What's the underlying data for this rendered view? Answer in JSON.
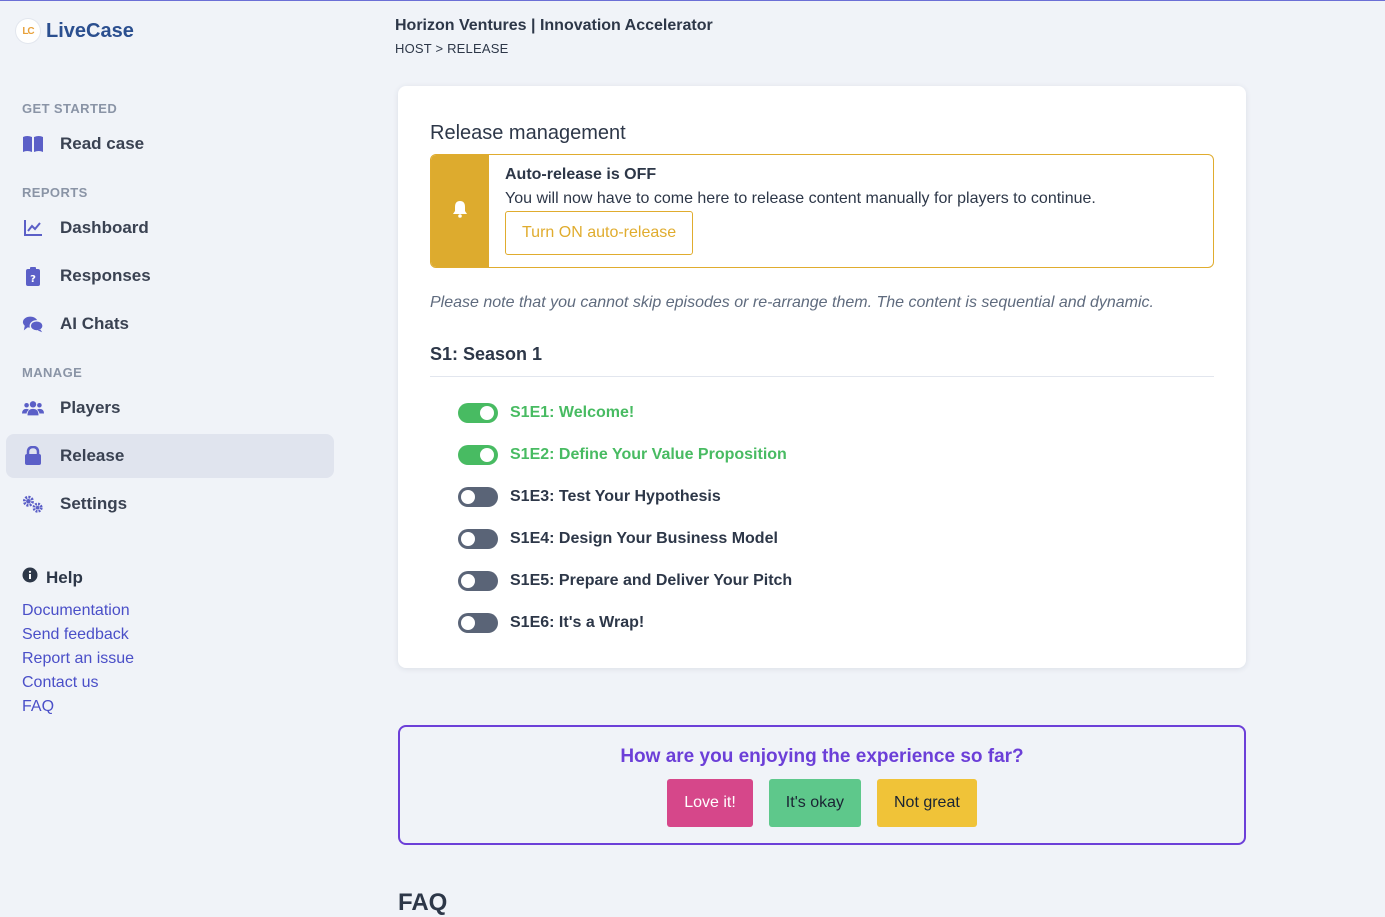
{
  "app": {
    "logo_text": "LiveCase",
    "logo_mark": "LC"
  },
  "header": {
    "title": "Horizon Ventures | Innovation Accelerator",
    "breadcrumb": "HOST > RELEASE"
  },
  "sidebar": {
    "sections": [
      {
        "label": "GET STARTED",
        "items": [
          {
            "label": "Read case",
            "icon": "book-icon"
          }
        ]
      },
      {
        "label": "REPORTS",
        "items": [
          {
            "label": "Dashboard",
            "icon": "chart-line-icon"
          },
          {
            "label": "Responses",
            "icon": "clipboard-question-icon"
          },
          {
            "label": "AI Chats",
            "icon": "chat-bubbles-icon"
          }
        ]
      },
      {
        "label": "MANAGE",
        "items": [
          {
            "label": "Players",
            "icon": "users-icon"
          },
          {
            "label": "Release",
            "icon": "lock-icon",
            "active": true
          },
          {
            "label": "Settings",
            "icon": "cogs-icon"
          }
        ]
      }
    ],
    "help": {
      "title": "Help",
      "links": [
        "Documentation",
        "Send feedback",
        "Report an issue",
        "Contact us",
        "FAQ"
      ]
    }
  },
  "release": {
    "title": "Release management",
    "alert": {
      "title": "Auto-release is OFF",
      "text": "You will now have to come here to release content manually for players to continue.",
      "button": "Turn ON auto-release",
      "color": "#ddab2e"
    },
    "note": "Please note that you cannot skip episodes or re-arrange them. The content is sequential and dynamic.",
    "season": "S1: Season 1",
    "episodes": [
      {
        "label": "S1E1: Welcome!",
        "released": true
      },
      {
        "label": "S1E2: Define Your Value Proposition",
        "released": true
      },
      {
        "label": "S1E3: Test Your Hypothesis",
        "released": false
      },
      {
        "label": "S1E4: Design Your Business Model",
        "released": false
      },
      {
        "label": "S1E5: Prepare and Deliver Your Pitch",
        "released": false
      },
      {
        "label": "S1E6: It's a Wrap!",
        "released": false
      }
    ]
  },
  "feedback": {
    "question": "How are you enjoying the experience so far?",
    "buttons": {
      "love": "Love it!",
      "okay": "It's okay",
      "bad": "Not great"
    }
  },
  "faq_heading": "FAQ"
}
